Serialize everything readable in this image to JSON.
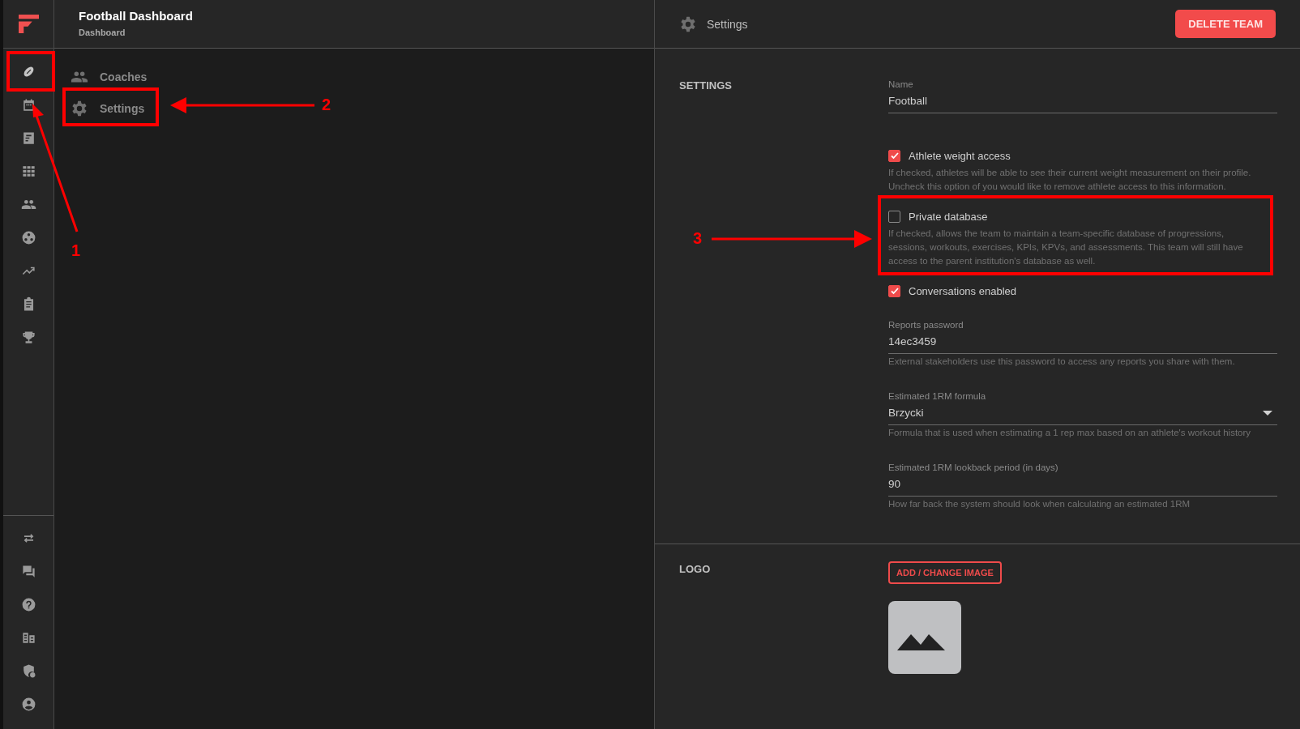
{
  "header": {
    "title": "Football Dashboard",
    "subtitle": "Dashboard"
  },
  "rail": {
    "top": [
      {
        "selected": true
      },
      {
        "selected": false
      },
      {
        "selected": false
      },
      {
        "selected": false
      },
      {
        "selected": false
      },
      {
        "selected": false
      },
      {
        "selected": false
      },
      {
        "selected": false
      },
      {
        "selected": false
      }
    ],
    "bottom": [
      {
        "selected": false
      },
      {
        "selected": false
      },
      {
        "selected": false
      },
      {
        "selected": false
      },
      {
        "selected": false
      },
      {
        "selected": false
      }
    ]
  },
  "nav": [
    {
      "label": "Coaches"
    },
    {
      "label": "Settings"
    }
  ],
  "panel": {
    "title": "Settings",
    "delete_button": "DELETE TEAM"
  },
  "settings": {
    "heading": "SETTINGS",
    "fields": [
      {
        "kind": "text",
        "label": "Name",
        "value": "Football"
      },
      {
        "kind": "checkbox",
        "label": "Athlete weight access",
        "checked": true,
        "help": "If checked, athletes will be able to see their current weight measurement on their profile. Uncheck this option of you would like to remove athlete access to this information."
      },
      {
        "kind": "checkbox",
        "label": "Private database",
        "checked": false,
        "help": "If checked, allows the team to maintain a team-specific database of progressions, sessions, workouts, exercises, KPIs, KPVs, and assessments. This team will still have access to the parent institution's database as well."
      },
      {
        "kind": "checkbox",
        "label": "Conversations enabled",
        "checked": true
      },
      {
        "kind": "text",
        "label": "Reports password",
        "value": "14ec3459",
        "help": "External stakeholders use this password to access any reports you share with them."
      },
      {
        "kind": "select",
        "label": "Estimated 1RM formula",
        "value": "Brzycki",
        "help": "Formula that is used when estimating a 1 rep max based on an athlete's workout history"
      },
      {
        "kind": "text",
        "label": "Estimated 1RM lookback period (in days)",
        "value": "90",
        "help": "How far back the system should look when calculating an estimated 1RM"
      }
    ]
  },
  "logo": {
    "heading": "LOGO",
    "button": "ADD / CHANGE IMAGE"
  },
  "annotations": [
    {
      "label": "1"
    },
    {
      "label": "2"
    },
    {
      "label": "3"
    }
  ]
}
